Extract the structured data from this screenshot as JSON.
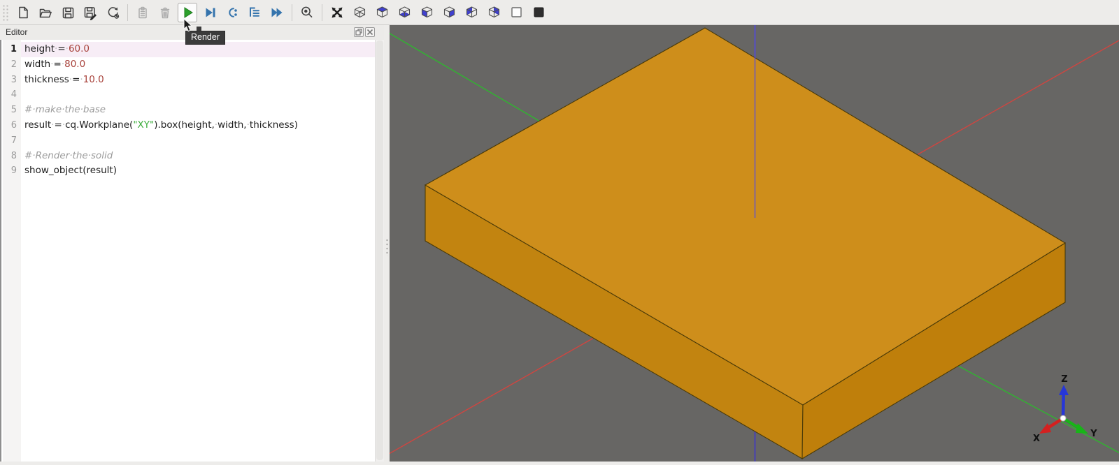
{
  "toolbar": {
    "icons": [
      "new-file",
      "open-file",
      "save",
      "save-as",
      "reload",
      "copy",
      "delete",
      "render",
      "debug",
      "step-over",
      "step-into",
      "continue",
      "magnifier",
      "fit-view",
      "view-iso",
      "view-top",
      "view-bottom",
      "view-front",
      "view-back",
      "view-left",
      "view-right",
      "wireframe",
      "shaded"
    ],
    "disabled_icons": [
      "copy",
      "delete"
    ],
    "hovered_icon": "render"
  },
  "tooltip": {
    "text": "Render"
  },
  "editor": {
    "title": "Editor",
    "lines": [
      {
        "num": "1",
        "current": true,
        "tokens": [
          {
            "t": "height",
            "c": "d"
          },
          {
            "t": "·",
            "c": "w"
          },
          {
            "t": "=",
            "c": "d"
          },
          {
            "t": "·",
            "c": "w"
          },
          {
            "t": "60.0",
            "c": "n"
          }
        ]
      },
      {
        "num": "2",
        "current": false,
        "tokens": [
          {
            "t": "width",
            "c": "d"
          },
          {
            "t": "·",
            "c": "w"
          },
          {
            "t": "=",
            "c": "d"
          },
          {
            "t": "·",
            "c": "w"
          },
          {
            "t": "80.0",
            "c": "n"
          }
        ]
      },
      {
        "num": "3",
        "current": false,
        "tokens": [
          {
            "t": "thickness",
            "c": "d"
          },
          {
            "t": "·",
            "c": "w"
          },
          {
            "t": "=",
            "c": "d"
          },
          {
            "t": "·",
            "c": "w"
          },
          {
            "t": "10.0",
            "c": "n"
          }
        ]
      },
      {
        "num": "4",
        "current": false,
        "tokens": []
      },
      {
        "num": "5",
        "current": false,
        "tokens": [
          {
            "t": "#·make·the·base",
            "c": "c"
          }
        ]
      },
      {
        "num": "6",
        "current": false,
        "tokens": [
          {
            "t": "result",
            "c": "d"
          },
          {
            "t": "·",
            "c": "w"
          },
          {
            "t": "=",
            "c": "d"
          },
          {
            "t": "·",
            "c": "w"
          },
          {
            "t": "cq.Workplane(",
            "c": "d"
          },
          {
            "t": "\"XY\"",
            "c": "s"
          },
          {
            "t": ").box(height,",
            "c": "d"
          },
          {
            "t": "·",
            "c": "w"
          },
          {
            "t": "width,",
            "c": "d"
          },
          {
            "t": "·",
            "c": "w"
          },
          {
            "t": "thickness)",
            "c": "d"
          }
        ]
      },
      {
        "num": "7",
        "current": false,
        "tokens": []
      },
      {
        "num": "8",
        "current": false,
        "tokens": [
          {
            "t": "#·Render·the·solid",
            "c": "c"
          }
        ]
      },
      {
        "num": "9",
        "current": false,
        "tokens": [
          {
            "t": "show_object(result)",
            "c": "d"
          }
        ]
      }
    ]
  },
  "viewport": {
    "colors": {
      "background": "#676664",
      "box_top": "#ce8e1b",
      "box_left": "#c28410",
      "box_right": "#bf7f0b",
      "box_edge": "#4a3a08",
      "axis_x": "#d04540",
      "axis_y": "#2fb62f",
      "axis_z": "#3a32cf",
      "axis_z_overlay": "#5a50dc",
      "triad_x": "#d42020",
      "triad_y": "#18b418",
      "triad_z": "#2636d8"
    },
    "triad": {
      "x": "X",
      "y": "Y",
      "z": "Z"
    }
  }
}
